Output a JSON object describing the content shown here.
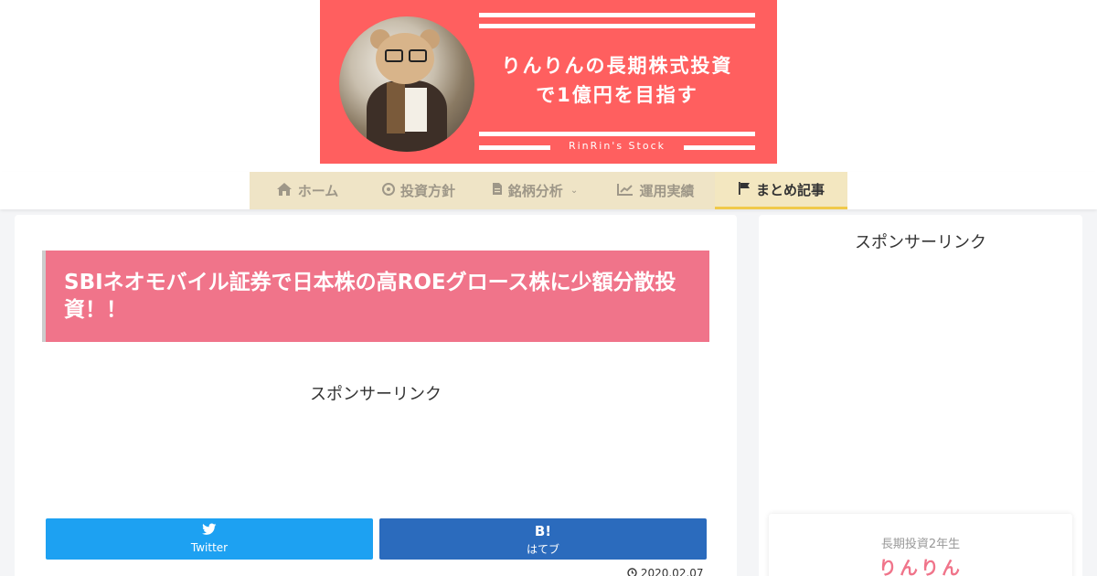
{
  "banner": {
    "title": "りんりんの長期株式投資\nで1億円を目指す",
    "subtitle": "RinRin's Stock",
    "bg_color": "#ff5f5f"
  },
  "nav": {
    "items": [
      {
        "label": "ホーム",
        "icon": "home-icon"
      },
      {
        "label": "投資方針",
        "icon": "circle-info-icon"
      },
      {
        "label": "銘柄分析",
        "icon": "document-icon",
        "has_dropdown": true
      },
      {
        "label": "運用実績",
        "icon": "line-chart-icon"
      },
      {
        "label": "まとめ記事",
        "icon": "flag-icon",
        "active": true
      }
    ]
  },
  "article": {
    "title": "SBIネオモバイル証券で日本株の高ROEグロース株に少額分散投資！！",
    "sponsor_label": "スポンサーリンク",
    "date": "2020.02.07"
  },
  "share": {
    "twitter_label": "Twitter",
    "hatena_icon": "B!",
    "hatena_label": "はてブ",
    "twitter_color": "#1da1f2",
    "hatena_color": "#2b6bbd"
  },
  "sidebar": {
    "sponsor_label": "スポンサーリンク",
    "profile_tag": "長期投資2年生",
    "profile_name": "りんりん"
  }
}
